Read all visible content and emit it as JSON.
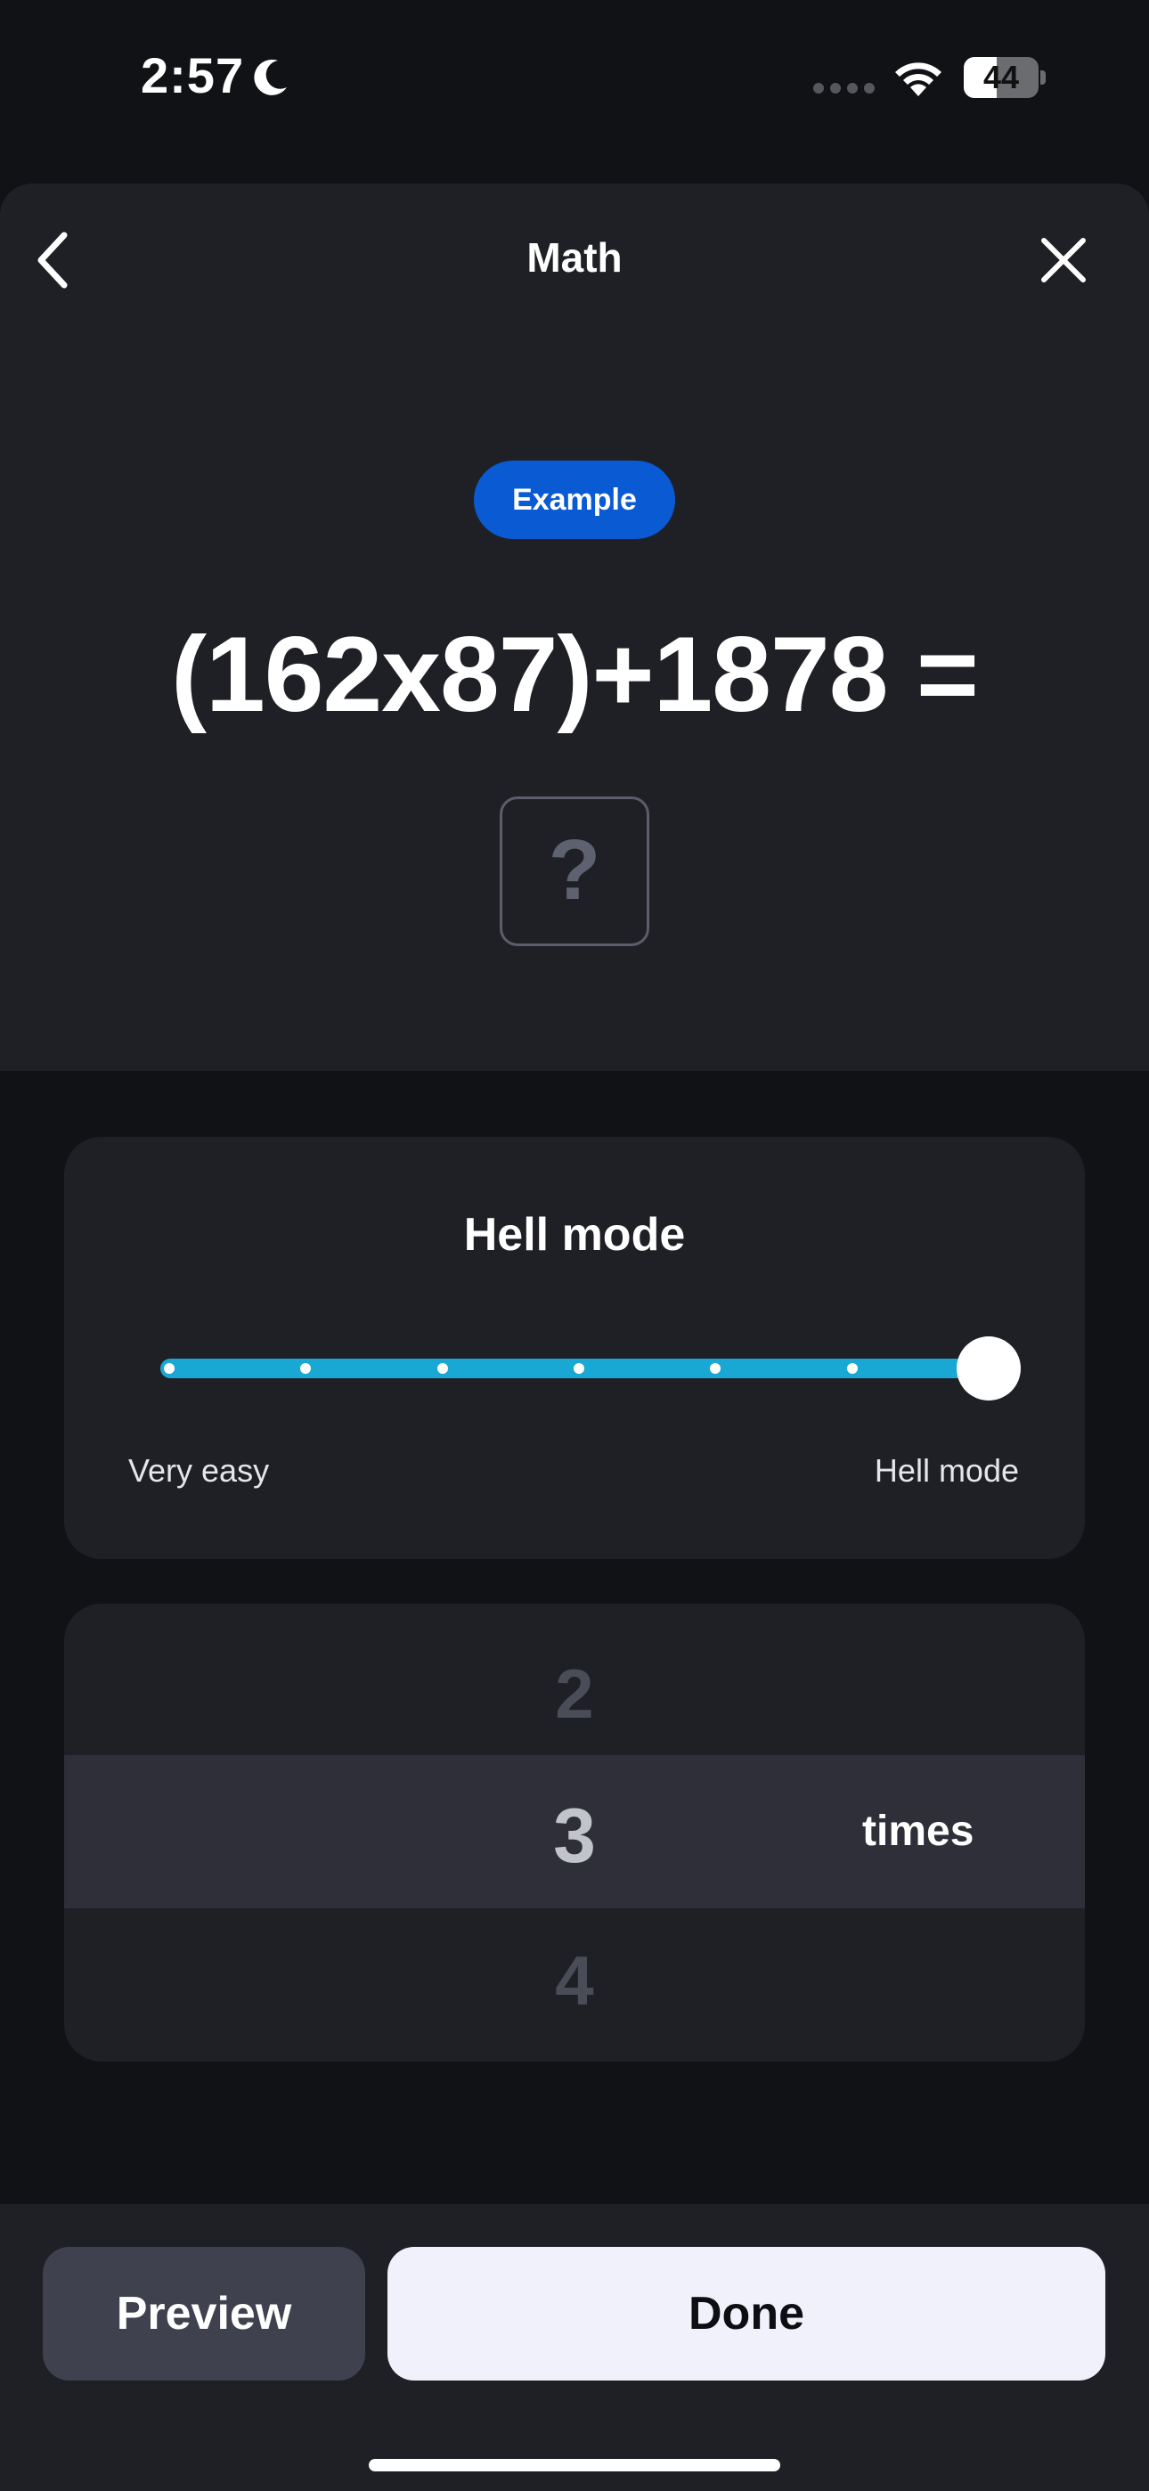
{
  "status_bar": {
    "time": "2:57",
    "battery_level": "44",
    "battery_fraction": 0.44
  },
  "nav": {
    "title": "Math",
    "back_icon": "chevron-left-icon",
    "close_icon": "close-icon"
  },
  "example": {
    "badge": "Example",
    "expression": "(162x87)+1878 =",
    "answer_placeholder": "?"
  },
  "difficulty": {
    "title": "Hell mode",
    "min_label": "Very easy",
    "max_label": "Hell mode",
    "levels": 7,
    "selected_level": 7,
    "track_color": "#19a7d3"
  },
  "repeat_picker": {
    "previous": "2",
    "selected": "3",
    "next": "4",
    "unit": "times"
  },
  "actions": {
    "preview_label": "Preview",
    "done_label": "Done"
  },
  "colors": {
    "accent_blue": "#0a5ad4",
    "card_bg": "#1f2026",
    "app_bg": "#111215"
  }
}
